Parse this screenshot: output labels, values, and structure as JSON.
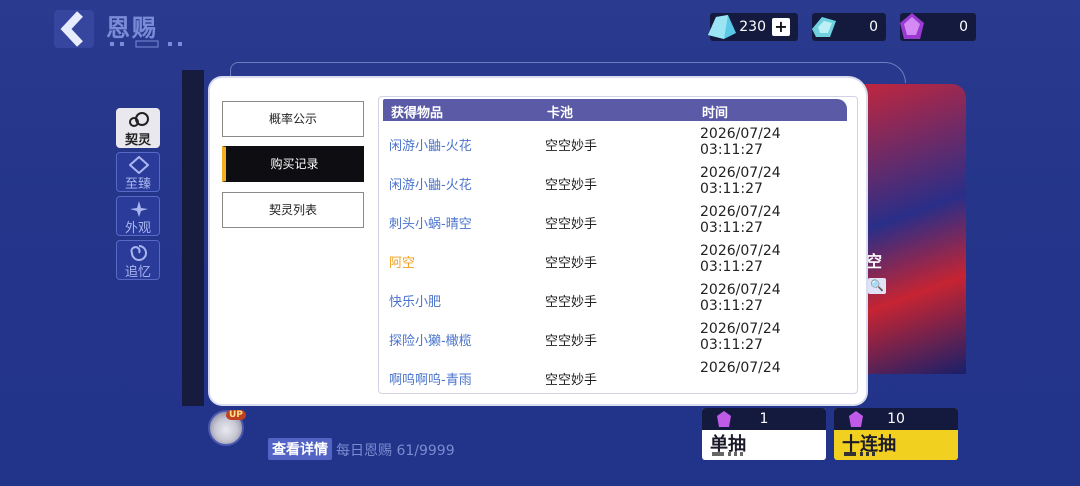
{
  "header": {
    "title": "恩赐"
  },
  "currencies": [
    {
      "icon": "crystal-ticket-icon",
      "value": "230",
      "has_plus": true
    },
    {
      "icon": "ticket-icon",
      "value": "0"
    },
    {
      "icon": "purple-gem-icon",
      "value": "0"
    }
  ],
  "side_tabs": [
    {
      "label": "契灵",
      "icon": "pet-icon",
      "active": true
    },
    {
      "label": "至臻",
      "icon": "emblem-icon",
      "active": false
    },
    {
      "label": "外观",
      "icon": "sparkle-icon",
      "active": false
    },
    {
      "label": "追忆",
      "icon": "swirl-icon",
      "active": false
    }
  ],
  "modal": {
    "menu": [
      {
        "label": "概率公示",
        "active": false
      },
      {
        "label": "购买记录",
        "active": true
      },
      {
        "label": "契灵列表",
        "active": false
      }
    ],
    "columns": [
      "获得物品",
      "卡池",
      "时间"
    ],
    "rows": [
      {
        "item": "闲游小鼬-火花",
        "pool": "空空妙手",
        "date": "2026/07/24",
        "time": "03:11:27",
        "gold": false
      },
      {
        "item": "闲游小鼬-火花",
        "pool": "空空妙手",
        "date": "2026/07/24",
        "time": "03:11:27",
        "gold": false
      },
      {
        "item": "刺头小蜗-晴空",
        "pool": "空空妙手",
        "date": "2026/07/24",
        "time": "03:11:27",
        "gold": false
      },
      {
        "item": "阿空",
        "pool": "空空妙手",
        "date": "2026/07/24",
        "time": "03:11:27",
        "gold": true
      },
      {
        "item": "快乐小肥",
        "pool": "空空妙手",
        "date": "2026/07/24",
        "time": "03:11:27",
        "gold": false
      },
      {
        "item": "探险小獭-橄榄",
        "pool": "空空妙手",
        "date": "2026/07/24",
        "time": "03:11:27",
        "gold": false
      },
      {
        "item": "啊呜啊呜-青雨",
        "pool": "空空妙手",
        "date": "2026/07/24",
        "time": "",
        "gold": false
      }
    ]
  },
  "background": {
    "banner_word": "空"
  },
  "bottom": {
    "detail_label": "查看详情",
    "daily_label": "每日恩赐 61/9999",
    "up_badge": "UP",
    "single": {
      "count": "1",
      "label": "单抽"
    },
    "ten": {
      "count": "10",
      "label": "十连抽"
    }
  },
  "colors": {
    "accent_purple": "#5a5aa6",
    "item_blue": "#4b74cc",
    "item_gold": "#f2a020",
    "draw_white": "#ffffff",
    "draw_yellow": "#f2d020"
  }
}
